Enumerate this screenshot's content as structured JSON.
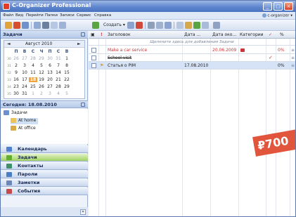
{
  "window": {
    "title": "C-Organizer Professional",
    "min": "_",
    "max": "□",
    "close": "×"
  },
  "menu": {
    "items": [
      "Файл",
      "Вид",
      "Перейти",
      "Папки",
      "Записи",
      "Сервис",
      "Справка"
    ],
    "account": "c-organizer"
  },
  "toolbar": {
    "create_label": "Создать"
  },
  "tasks_pane": {
    "title": "Задачи"
  },
  "calendar": {
    "month": "Август 2010",
    "prev": "◄",
    "next": "►",
    "weekday_headers": [
      "П",
      "В",
      "С",
      "Ч",
      "П",
      "С",
      "В"
    ],
    "weeks": [
      {
        "wk": "30",
        "days": [
          "26",
          "27",
          "28",
          "29",
          "30",
          "31",
          "1"
        ]
      },
      {
        "wk": "31",
        "days": [
          "2",
          "3",
          "4",
          "5",
          "6",
          "7",
          "8"
        ]
      },
      {
        "wk": "32",
        "days": [
          "9",
          "10",
          "11",
          "12",
          "13",
          "14",
          "15"
        ]
      },
      {
        "wk": "33",
        "days": [
          "16",
          "17",
          "18",
          "19",
          "20",
          "21",
          "22"
        ]
      },
      {
        "wk": "34",
        "days": [
          "23",
          "24",
          "25",
          "26",
          "27",
          "28",
          "29"
        ]
      },
      {
        "wk": "35",
        "days": [
          "30",
          "31",
          "1",
          "2",
          "3",
          "4",
          "5"
        ]
      }
    ],
    "today_day": "18"
  },
  "today": {
    "label": "Сегодня: 18.08.2010"
  },
  "tree": {
    "root": "Задачи",
    "children": [
      "At home",
      "At office"
    ]
  },
  "nav": {
    "items": [
      {
        "label": "Календарь",
        "color": "#4f7fcf"
      },
      {
        "label": "Задачи",
        "color": "#5fae2e",
        "active": true
      },
      {
        "label": "Контакты",
        "color": "#3f8f6a"
      },
      {
        "label": "Пароли",
        "color": "#4a7ec4"
      },
      {
        "label": "Заметки",
        "color": "#6d87b9"
      },
      {
        "label": "События",
        "color": "#c74a4a"
      }
    ],
    "more": "»"
  },
  "grid": {
    "columns": [
      "!",
      "Заголовок",
      "Дата ...",
      "Дата око...",
      "Категории",
      "✓",
      "%"
    ],
    "hint": "Щелкните здесь для добавления Задачи",
    "rows": [
      {
        "title": "Make a car service",
        "start": "",
        "due": "20.06.2009",
        "category_color": "#c9353a",
        "done": "",
        "percent": "0%",
        "style": "overdue"
      },
      {
        "title": "School visit",
        "start": "",
        "due": "",
        "category_color": "",
        "done": "✓",
        "percent": "",
        "style": "done"
      },
      {
        "title": "Статья о PIM",
        "start": "17.08.2010",
        "due": "",
        "category_color": "",
        "done": "",
        "percent": "0%",
        "style": "normal"
      }
    ]
  },
  "price": {
    "text": "₽700"
  }
}
